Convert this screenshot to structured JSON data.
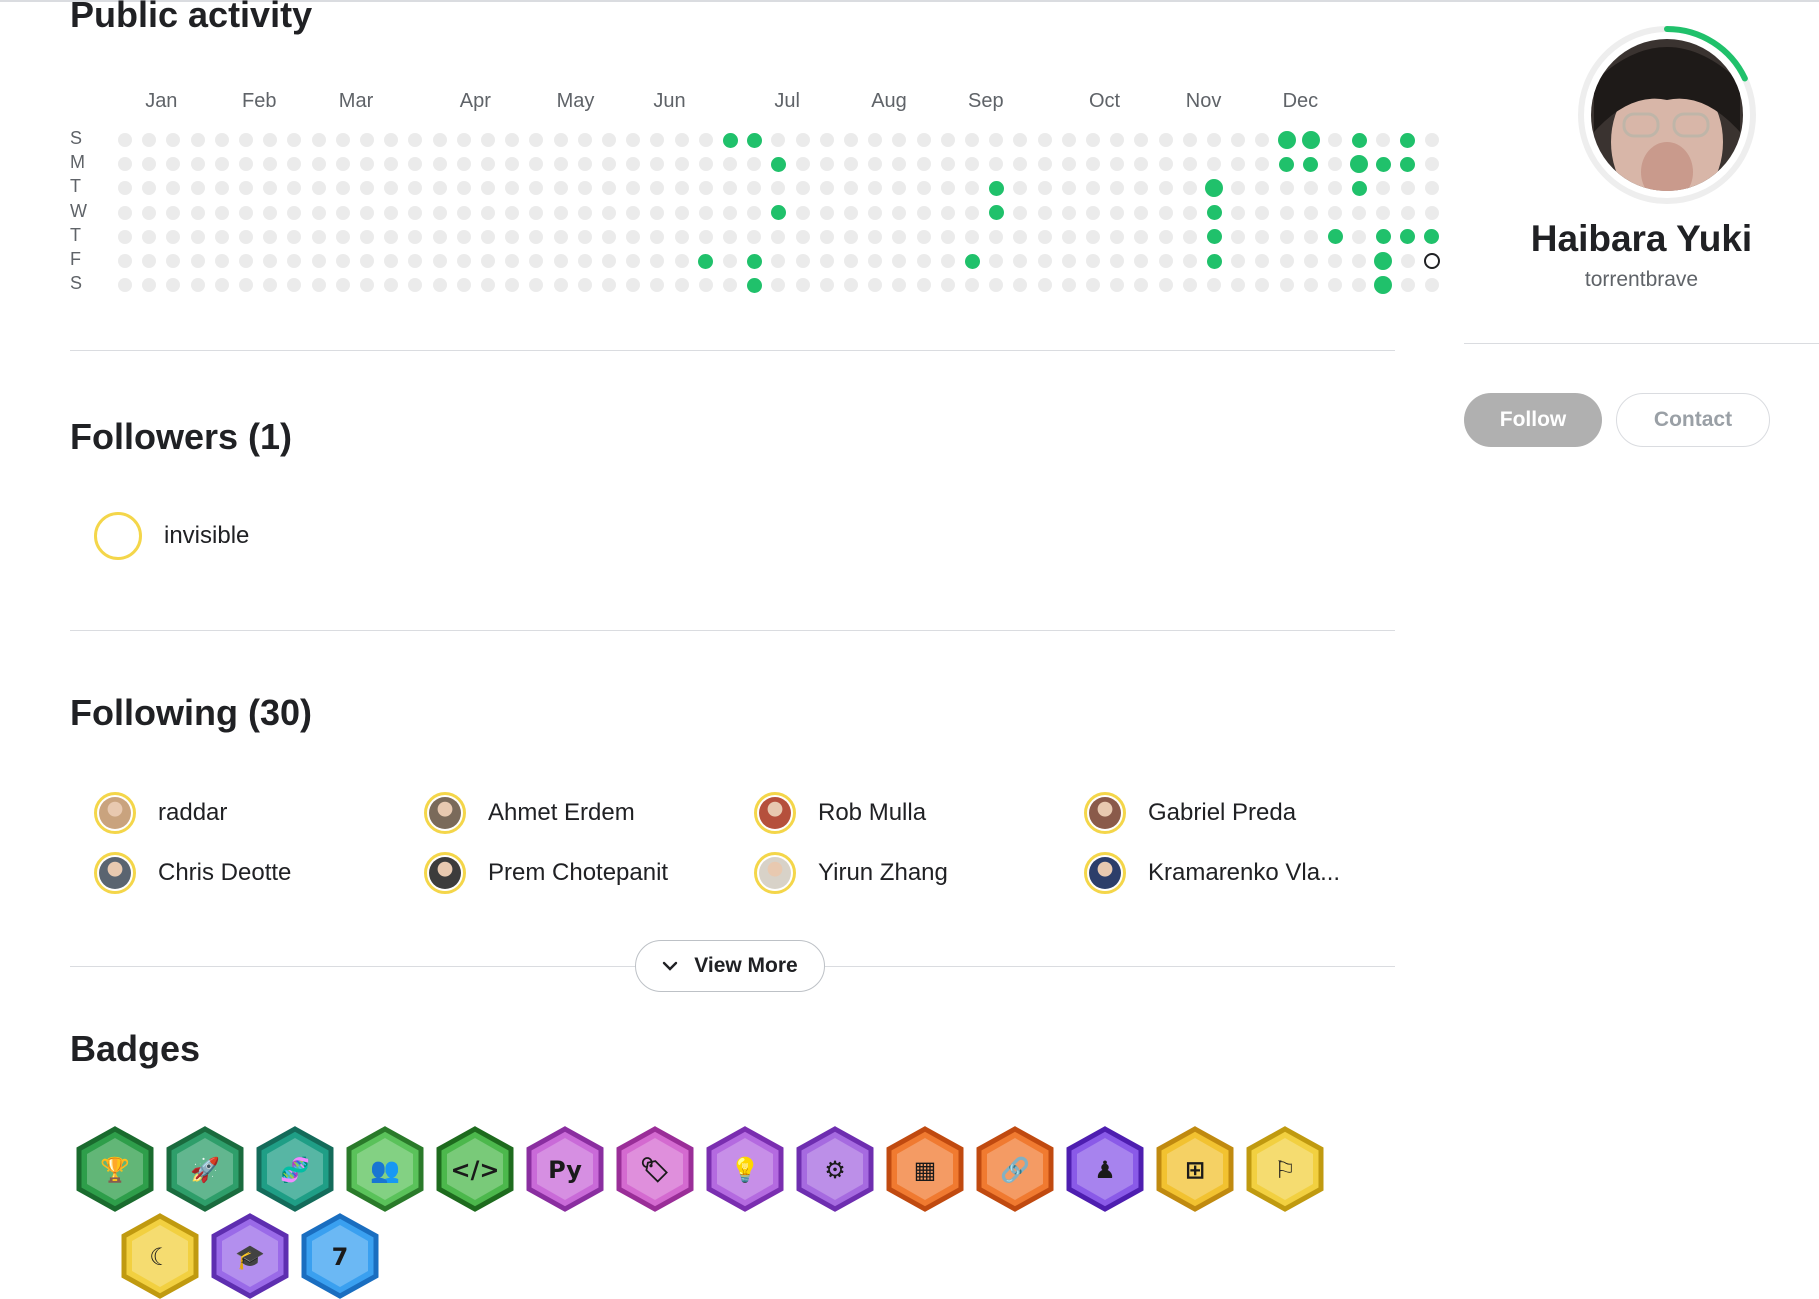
{
  "activity": {
    "title": "Public activity",
    "months": [
      "Jan",
      "Feb",
      "Mar",
      "Apr",
      "May",
      "Jun",
      "Jul",
      "Aug",
      "Sep",
      "Oct",
      "Nov",
      "Dec"
    ],
    "days": [
      "S",
      "M",
      "T",
      "W",
      "T",
      "F",
      "S"
    ],
    "colors": {
      "empty": "#ebebeb",
      "active": "#20c16b",
      "today_border": "#202124"
    },
    "active_cells": [
      {
        "week": 25,
        "day": 0,
        "level": 1
      },
      {
        "week": 26,
        "day": 0,
        "level": 1
      },
      {
        "week": 48,
        "day": 0,
        "level": 2
      },
      {
        "week": 49,
        "day": 0,
        "level": 2
      },
      {
        "week": 51,
        "day": 0,
        "level": 1
      },
      {
        "week": 53,
        "day": 0,
        "level": 1
      },
      {
        "week": 27,
        "day": 1,
        "level": 1
      },
      {
        "week": 48,
        "day": 1,
        "level": 1
      },
      {
        "week": 49,
        "day": 1,
        "level": 1
      },
      {
        "week": 51,
        "day": 1,
        "level": 2
      },
      {
        "week": 52,
        "day": 1,
        "level": 1
      },
      {
        "week": 53,
        "day": 1,
        "level": 1
      },
      {
        "week": 36,
        "day": 2,
        "level": 1
      },
      {
        "week": 45,
        "day": 2,
        "level": 2
      },
      {
        "week": 51,
        "day": 2,
        "level": 1
      },
      {
        "week": 27,
        "day": 3,
        "level": 1
      },
      {
        "week": 36,
        "day": 3,
        "level": 1
      },
      {
        "week": 45,
        "day": 3,
        "level": 1
      },
      {
        "week": 45,
        "day": 4,
        "level": 1
      },
      {
        "week": 50,
        "day": 4,
        "level": 1
      },
      {
        "week": 52,
        "day": 4,
        "level": 1
      },
      {
        "week": 53,
        "day": 4,
        "level": 1
      },
      {
        "week": 54,
        "day": 4,
        "level": 1
      },
      {
        "week": 24,
        "day": 5,
        "level": 1
      },
      {
        "week": 26,
        "day": 5,
        "level": 1
      },
      {
        "week": 35,
        "day": 5,
        "level": 1
      },
      {
        "week": 45,
        "day": 5,
        "level": 1
      },
      {
        "week": 52,
        "day": 5,
        "level": 2
      },
      {
        "week": 26,
        "day": 6,
        "level": 1
      },
      {
        "week": 52,
        "day": 6,
        "level": 2
      }
    ],
    "today": {
      "week": 54,
      "day": 5
    }
  },
  "followers": {
    "title": "Followers (1)",
    "items": [
      {
        "name": "invisible"
      }
    ]
  },
  "following": {
    "title": "Following (30)",
    "items": [
      {
        "name": "raddar",
        "color": "#c9a37e"
      },
      {
        "name": "Ahmet Erdem",
        "color": "#7a6a5a"
      },
      {
        "name": "Rob Mulla",
        "color": "#b5503c"
      },
      {
        "name": "Gabriel Preda",
        "color": "#8a5a4a"
      },
      {
        "name": "Chris Deotte",
        "color": "#5a6470"
      },
      {
        "name": "Prem Chotepanit",
        "color": "#3c3c3c"
      },
      {
        "name": "Yirun Zhang",
        "color": "#d8d2c8"
      },
      {
        "name": "Kramarenko Vla...",
        "color": "#2c3e6a"
      }
    ],
    "view_more": "View More"
  },
  "badges": {
    "title": "Badges",
    "items": [
      {
        "icon": "trophy-icon",
        "color": "#2e9e4a",
        "border": "#1a6b2e"
      },
      {
        "icon": "rocket-icon",
        "color": "#2e9e6a",
        "border": "#1a6b3e"
      },
      {
        "icon": "dna-icon",
        "color": "#1f9e86",
        "border": "#146b5a"
      },
      {
        "icon": "people-icon",
        "color": "#5ac25a",
        "border": "#2a7a2a"
      },
      {
        "icon": "code-icon",
        "color": "#4cb84c",
        "border": "#1e6b1e"
      },
      {
        "icon": "python-icon",
        "color": "#c96ad8",
        "border": "#8a2ea0"
      },
      {
        "icon": "tag-code-icon",
        "color": "#d46ad0",
        "border": "#9a2e98"
      },
      {
        "icon": "lightbulb-icon",
        "color": "#b46ae0",
        "border": "#7a2eb0"
      },
      {
        "icon": "network-icon",
        "color": "#a66ae0",
        "border": "#6e2eb0"
      },
      {
        "icon": "table-add-icon",
        "color": "#f07a30",
        "border": "#c04a10"
      },
      {
        "icon": "link-icon",
        "color": "#f07a30",
        "border": "#c04a10"
      },
      {
        "icon": "pawn-icon",
        "color": "#8a5ae8",
        "border": "#4e1eb0"
      },
      {
        "icon": "notebook-add-icon",
        "color": "#f2c230",
        "border": "#c08a10"
      },
      {
        "icon": "bookmark-add-icon",
        "color": "#f2d040",
        "border": "#c09a10"
      },
      {
        "icon": "moon-icon",
        "color": "#f2d040",
        "border": "#c09a10"
      },
      {
        "icon": "graduation-icon",
        "color": "#9a6ae8",
        "border": "#5e2eb0"
      },
      {
        "icon": "calendar-icon",
        "color": "#3aa0f0",
        "border": "#1a6ec0"
      }
    ]
  },
  "profile": {
    "name": "Haibara Yuki",
    "username": "torrentbrave",
    "progress_ring_color": "#20c16b",
    "progress_fraction": 0.18,
    "follow_label": "Follow",
    "contact_label": "Contact"
  }
}
